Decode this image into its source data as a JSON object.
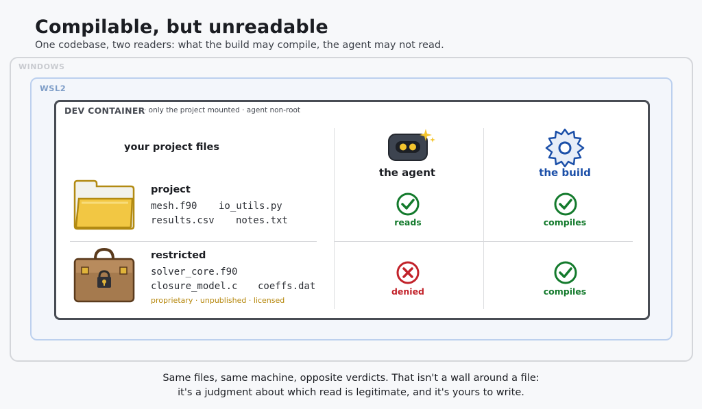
{
  "title": "Compilable, but unreadable",
  "subtitle": "One codebase, two readers: what the build may compile, the agent may not read.",
  "frames": {
    "windows": "WINDOWS",
    "wsl": "WSL2",
    "dev": "DEV CONTAINER",
    "dev_note": "· only the project mounted · agent non-root"
  },
  "files_heading": "your project files",
  "project": {
    "title": "project",
    "files": [
      "mesh.f90",
      "io_utils.py",
      "results.csv",
      "notes.txt"
    ]
  },
  "restricted": {
    "title": "restricted",
    "files": [
      "solver_core.f90",
      "closure_model.c",
      "coeffs.dat"
    ],
    "note": "proprietary · unpublished · licensed"
  },
  "columns": {
    "agent": "the agent",
    "build": "the build"
  },
  "verdicts": {
    "agent_project": "reads",
    "build_project": "compiles",
    "agent_restricted": "denied",
    "build_restricted": "compiles"
  },
  "colors": {
    "allow": "#137a2c",
    "deny": "#c2222a",
    "build": "#1b4fa8",
    "restricted_note": "#b5860a"
  },
  "footer": {
    "line1": "Same files, same machine, opposite verdicts. That isn't a wall around a file:",
    "line2": "it's a judgment about which read is legitimate, and it's yours to write."
  }
}
